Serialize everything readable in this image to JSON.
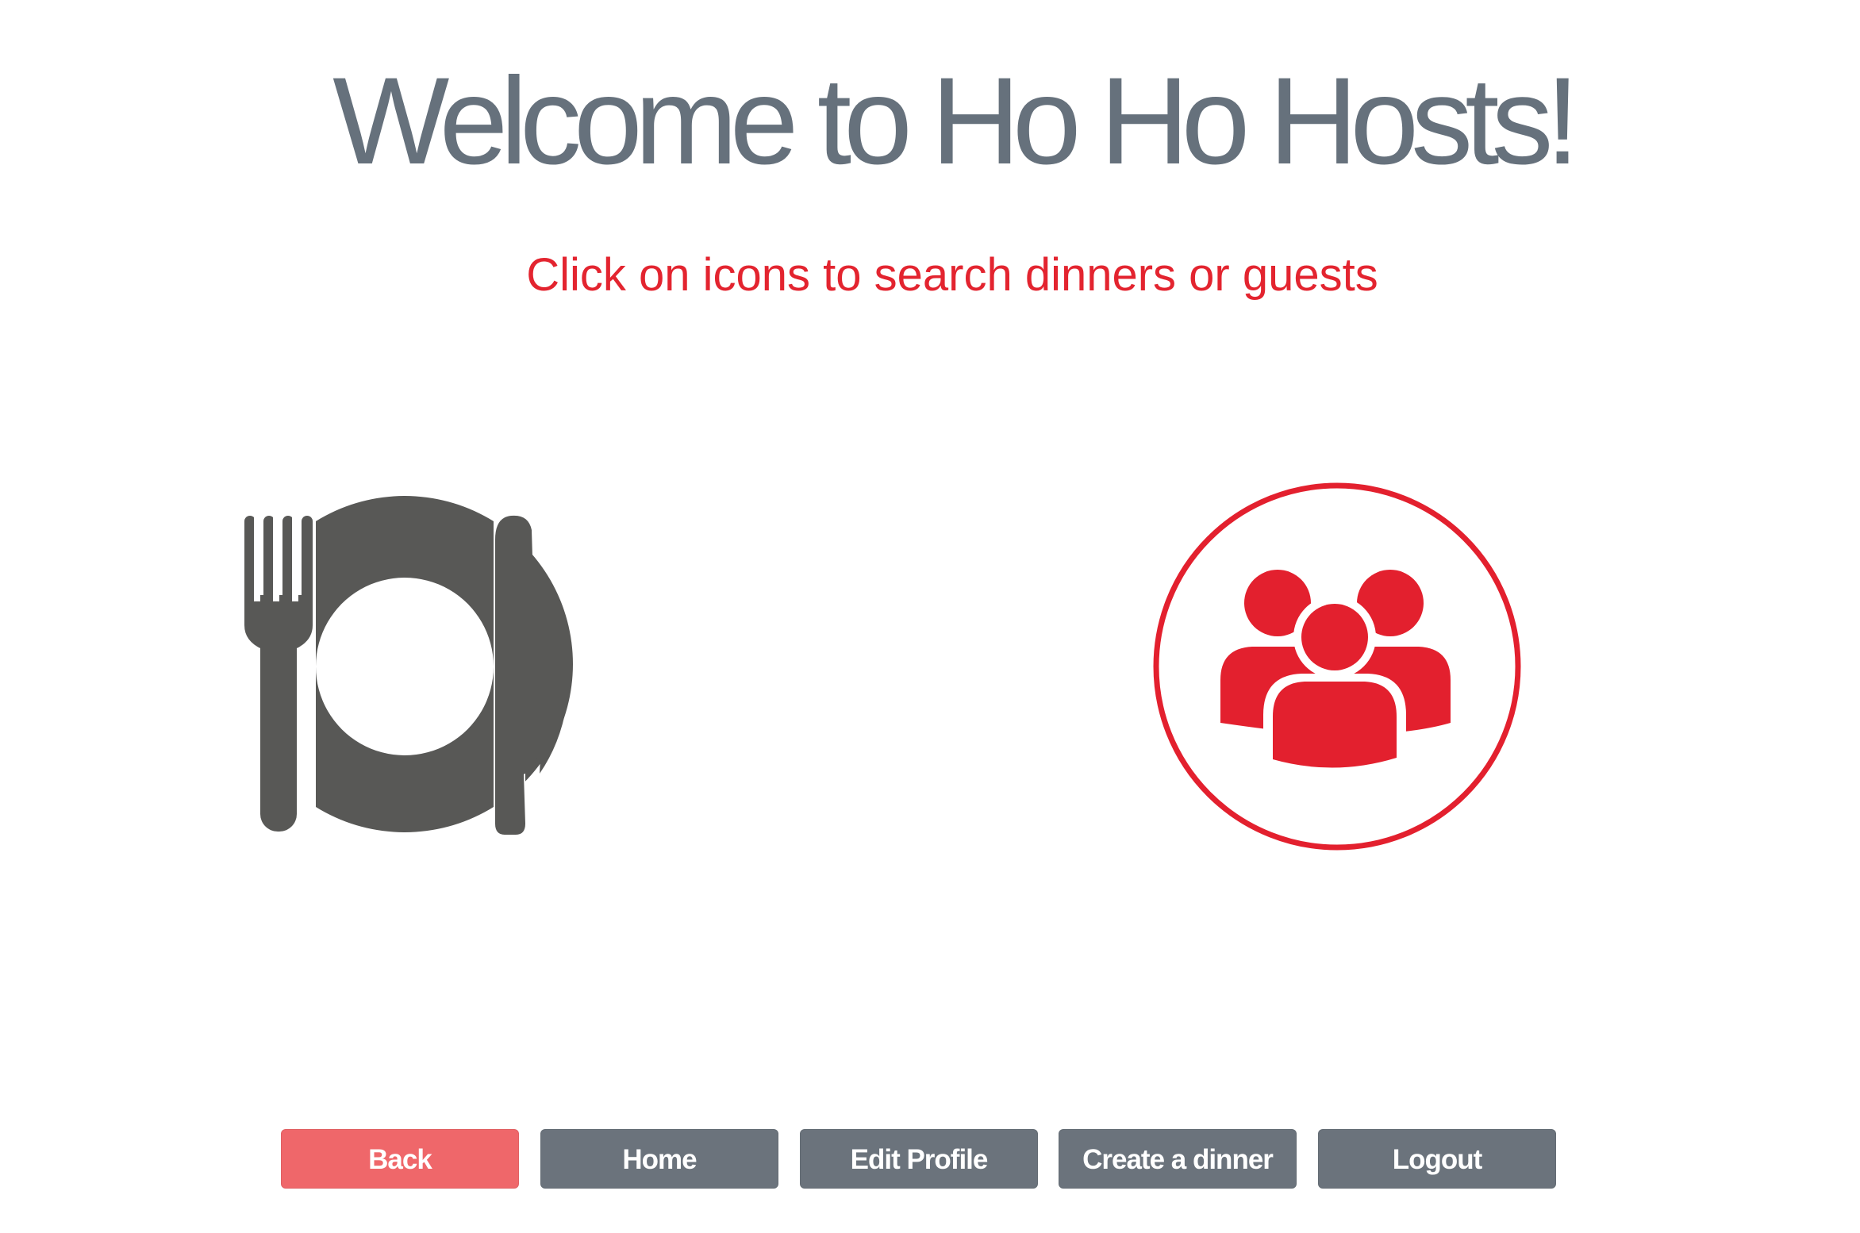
{
  "header": {
    "title": "Welcome to Ho Ho Hosts!",
    "subtitle": "Click on icons to search dinners or guests"
  },
  "icons": {
    "dinners": {
      "name": "plate-fork-knife-icon",
      "color": "#585856"
    },
    "guests": {
      "name": "group-people-icon",
      "color": "#e3202e"
    }
  },
  "nav": {
    "back_label": "Back",
    "home_label": "Home",
    "edit_profile_label": "Edit Profile",
    "create_dinner_label": "Create a dinner",
    "logout_label": "Logout"
  },
  "colors": {
    "title": "#66717c",
    "accent_red": "#e3242f",
    "back_button": "#ef676a",
    "nav_button": "#6b737c"
  }
}
